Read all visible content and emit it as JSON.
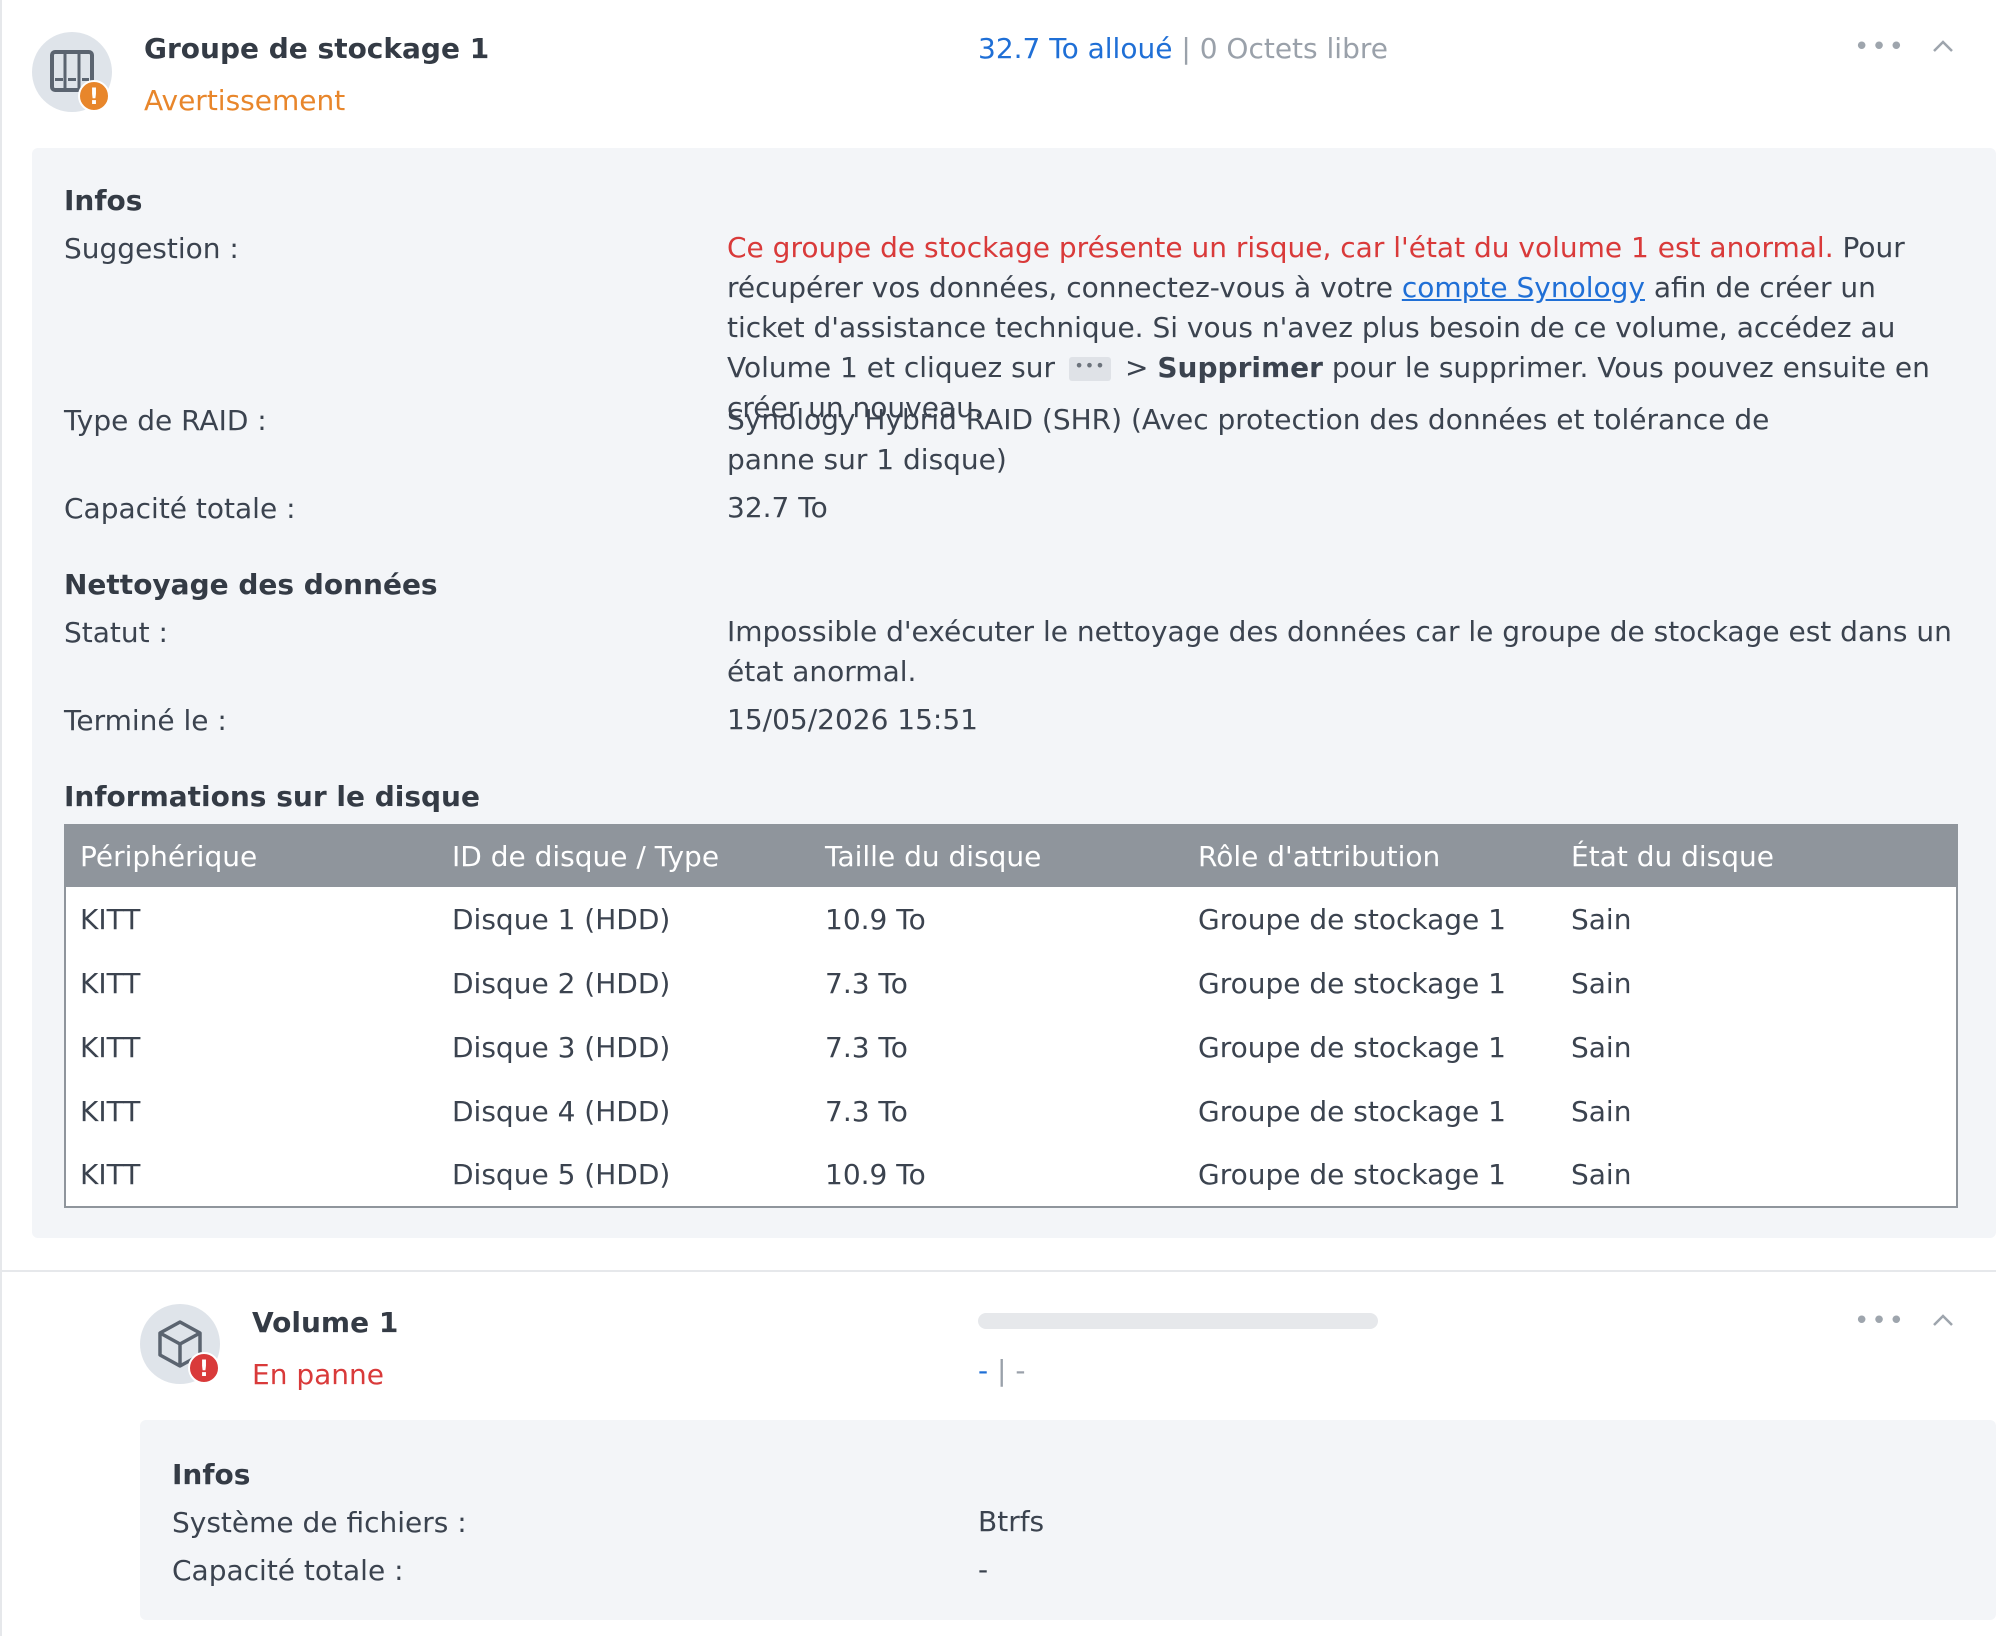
{
  "pool": {
    "title": "Groupe de stockage 1",
    "status": "Avertissement",
    "capacity_allocated": "32.7 To alloué",
    "capacity_separator": " | ",
    "capacity_free": "0 Octets libre",
    "more_label": "•••",
    "icon": "storage-pool-icon",
    "badge": "!",
    "info": {
      "section_title": "Infos",
      "suggestion_label": "Suggestion :",
      "suggestion_warning": "Ce groupe de stockage présente un risque, car l'état du volume 1 est anormal.",
      "suggestion_text_1": " Pour récupérer vos données, connectez-vous à votre ",
      "suggestion_link": "compte Synology",
      "suggestion_text_2": " afin de créer un ticket d'assistance technique. Si vous n'avez plus besoin de ce volume, accédez au Volume 1 et cliquez sur",
      "suggestion_more": "•••",
      "suggestion_text_3": "> ",
      "suggestion_bold": "Supprimer",
      "suggestion_text_4": " pour le supprimer. Vous pouvez ensuite en créer un nouveau.",
      "raid_label": "Type de RAID :",
      "raid_value": "Synology Hybrid RAID (SHR) (Avec protection des données et tolérance de panne sur 1 disque)",
      "capacity_label": "Capacité totale :",
      "capacity_value": "32.7 To"
    },
    "scrub": {
      "section_title": "Nettoyage des données",
      "status_label": "Statut :",
      "status_value": "Impossible d'exécuter le nettoyage des données car le groupe de stockage est dans un état anormal.",
      "finished_label": "Terminé le :",
      "finished_value": "15/05/2026 15:51"
    },
    "disks": {
      "section_title": "Informations sur le disque",
      "columns": [
        "Périphérique",
        "ID de disque / Type",
        "Taille du disque",
        "Rôle d'attribution",
        "État du disque"
      ],
      "rows": [
        [
          "KITT",
          "Disque 1 (HDD)",
          "10.9 To",
          "Groupe de stockage 1",
          "Sain"
        ],
        [
          "KITT",
          "Disque 2 (HDD)",
          "7.3 To",
          "Groupe de stockage 1",
          "Sain"
        ],
        [
          "KITT",
          "Disque 3 (HDD)",
          "7.3 To",
          "Groupe de stockage 1",
          "Sain"
        ],
        [
          "KITT",
          "Disque 4 (HDD)",
          "7.3 To",
          "Groupe de stockage 1",
          "Sain"
        ],
        [
          "KITT",
          "Disque 5 (HDD)",
          "10.9 To",
          "Groupe de stockage 1",
          "Sain"
        ]
      ]
    }
  },
  "volume": {
    "title": "Volume 1",
    "status": "En panne",
    "capacity_used": "-",
    "capacity_separator": " | ",
    "capacity_free": "-",
    "more_label": "•••",
    "icon": "volume-cube-icon",
    "badge": "!",
    "usage_fraction": 0,
    "info": {
      "section_title": "Infos",
      "fs_label": "Système de fichiers :",
      "fs_value": "Btrfs",
      "capacity_label": "Capacité totale :",
      "capacity_value": "-"
    }
  },
  "colors": {
    "warning": "#e8862b",
    "error": "#d93a3a",
    "healthy": "#2e9b1f",
    "link": "#1f6fd6",
    "panel_bg": "#f3f5f8",
    "table_header": "#8f959c"
  }
}
